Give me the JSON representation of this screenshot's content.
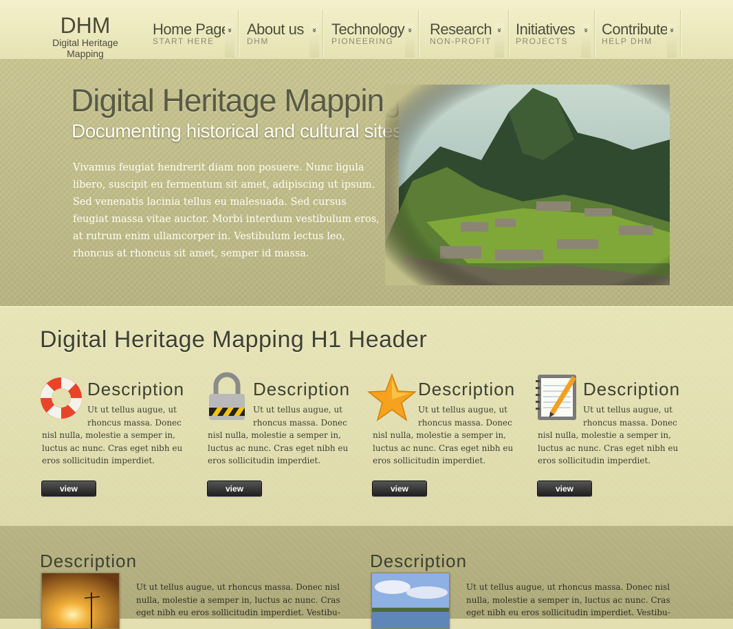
{
  "logo": {
    "abbr": "DHM",
    "full": "Digital Heritage Mapping"
  },
  "nav": [
    {
      "title": "Home Page",
      "sub": "START HERE"
    },
    {
      "title": "About us",
      "sub": "DHM"
    },
    {
      "title": "Technology",
      "sub": "PIONEERING"
    },
    {
      "title": "Research",
      "sub": "NON-PROFIT"
    },
    {
      "title": "Initiatives",
      "sub": "PROJECTS"
    },
    {
      "title": "Contribute",
      "sub": "HELP DHM"
    }
  ],
  "nav_arrow": "»",
  "hero": {
    "title": "Digital Heritage Mapping",
    "subtitle": "Documenting historical and cultural sites",
    "text": "Vivamus feugiat hendrerit diam non posuere. Nunc ligula libero, suscipit eu fermentum sit amet, adipiscing ut ipsum. Sed venenatis lacinia tellus eu malesuada. Sed cursus feugiat massa vitae auctor. Morbi interdum vestibulum eros, at rutrum enim ullamcorper in. Vestibulum lectus leo, rhoncus at rhoncus sit amet, semper id massa."
  },
  "features": {
    "heading": "Digital Heritage Mapping H1 Header",
    "items": [
      {
        "icon": "lifebuoy-icon",
        "title": "Description",
        "text_top": "Ut ut tellus augue, ut rhoncus massa. Donec",
        "text": "nisl nulla, molestie a semper in, luctus ac nunc. Cras eget nibh eu eros sollicitudin imperdiet.",
        "button": "view"
      },
      {
        "icon": "padlock-icon",
        "title": "Description",
        "text_top": "Ut ut tellus augue, ut rhoncus massa. Donec",
        "text": "nisl nulla, molestie a semper in, luctus ac nunc. Cras eget nibh eu eros sollicitudin imperdiet.",
        "button": "view"
      },
      {
        "icon": "star-icon",
        "title": "Description",
        "text_top": "Ut ut tellus augue, ut rhoncus massa. Donec",
        "text": "nisl nulla, molestie a semper in, luctus ac nunc. Cras eget nibh eu eros sollicitudin imperdiet.",
        "button": "view"
      },
      {
        "icon": "notepad-pencil-icon",
        "title": "Description",
        "text_top": "Ut ut tellus augue, ut rhoncus massa. Donec",
        "text": "nisl nulla, molestie a semper in, luctus ac nunc. Cras eget nibh eu eros sollicitudin imperdiet.",
        "button": "view"
      }
    ]
  },
  "bottom": [
    {
      "title": "Description",
      "text": "Ut ut tellus augue, ut rhoncus massa. Donec nisl nulla, molestie a semper in, luctus ac nunc. Cras eget nibh eu eros sollicitudin imperdiet. Vestibu-"
    },
    {
      "title": "Description",
      "text": "Ut ut tellus augue, ut rhoncus massa. Donec nisl nulla, molestie a semper in, luctus ac nunc. Cras eget nibh eu eros sollicitudin imperdiet. Vestibu-"
    }
  ]
}
